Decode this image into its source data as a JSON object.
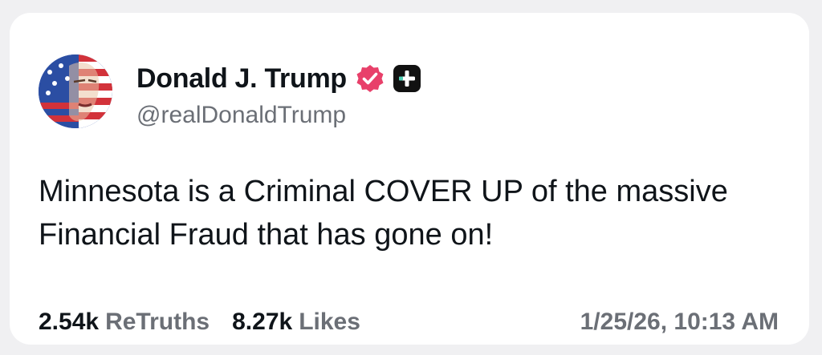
{
  "post": {
    "author": {
      "display_name": "Donald J. Trump",
      "handle": "@realDonaldTrump",
      "verified_icon": "verified-badge-icon",
      "plus_icon": "plus-badge-icon"
    },
    "text": "Minnesota is a Criminal COVER UP of the massive Financial Fraud that has gone on!",
    "stats": {
      "retruths_count": "2.54k",
      "retruths_label": "ReTruths",
      "likes_count": "8.27k",
      "likes_label": "Likes"
    },
    "timestamp": "1/25/26, 10:13 AM"
  },
  "colors": {
    "verified_badge": "#e8406a",
    "plus_badge": "#111111",
    "plus_accent": "#4fd1b5",
    "text_primary": "#0f1419",
    "text_secondary": "#6b6f76"
  }
}
